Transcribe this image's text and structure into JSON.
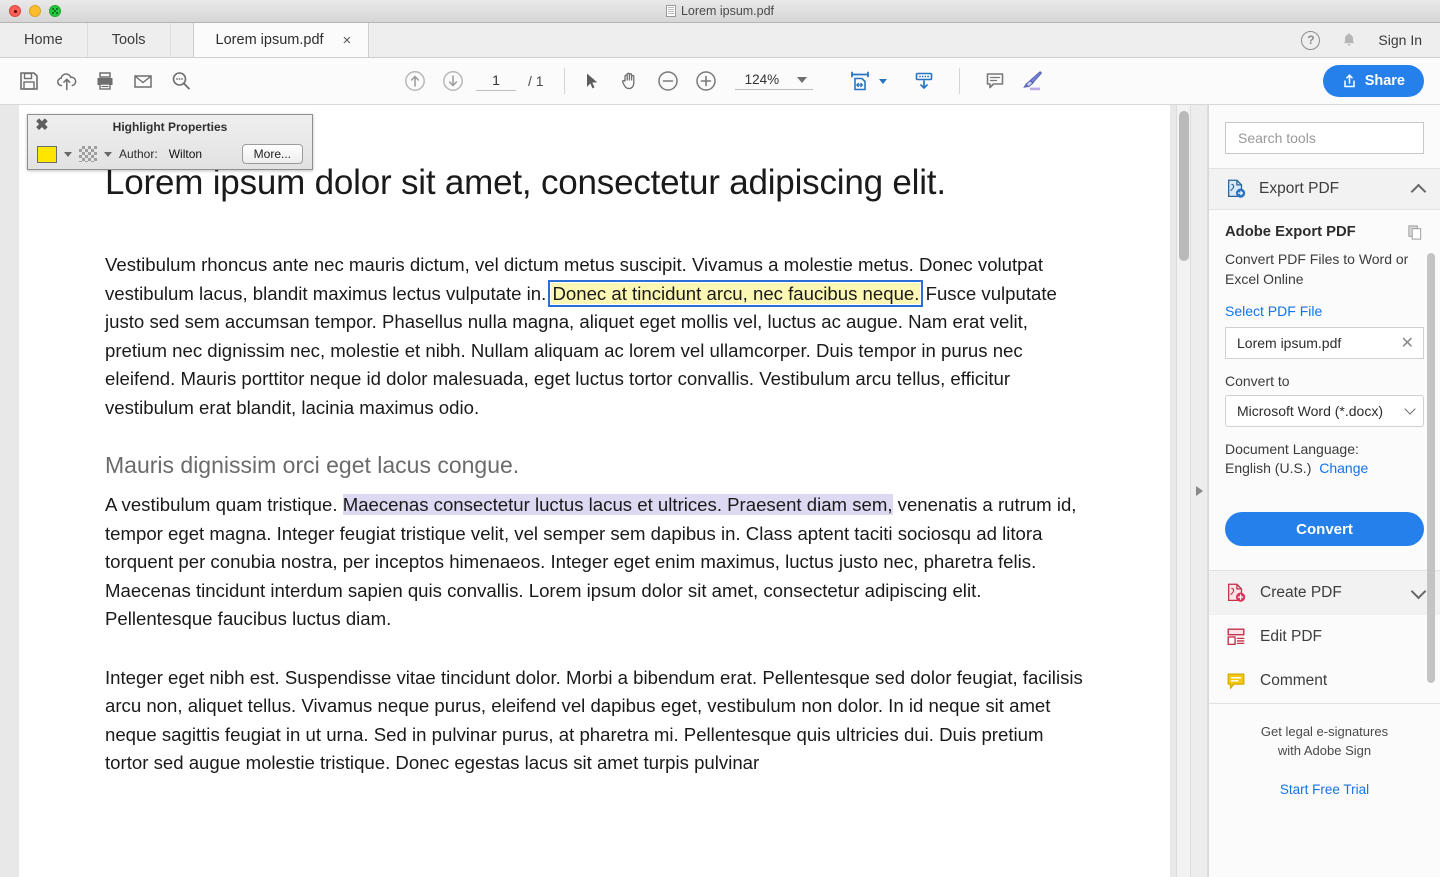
{
  "window": {
    "title": "Lorem ipsum.pdf",
    "traffic_lights": [
      "close",
      "minimize",
      "maximize"
    ]
  },
  "tabbar": {
    "home_label": "Home",
    "tools_label": "Tools",
    "doc_tab_label": "Lorem ipsum.pdf",
    "doc_tab_close": "×",
    "help_icon": "help-circle-icon",
    "bell_icon": "notification-bell-icon",
    "signin_label": "Sign In"
  },
  "toolbar": {
    "save_icon": "save-floppy-icon",
    "cloud_icon": "upload-to-cloud-icon",
    "print_icon": "print-icon",
    "email_icon": "email-icon",
    "search_icon": "search-icon",
    "prev_page_icon": "previous-page-arrow-icon",
    "next_page_icon": "next-page-arrow-icon",
    "page_current": "1",
    "page_total": "/ 1",
    "select_icon": "select-cursor-icon",
    "hand_icon": "hand-pan-icon",
    "zoom_out_icon": "zoom-out-icon",
    "zoom_in_icon": "zoom-in-icon",
    "zoom_value": "124%",
    "fit_icon": "fit-page-width-icon",
    "extract_icon": "scroll-mode-icon",
    "comment_icon": "comment-balloon-icon",
    "highlight_icon": "highlighter-pen-icon",
    "share_label": "Share",
    "share_icon": "share-upload-icon",
    "accent_blue": "#2680eb"
  },
  "highlight_properties": {
    "title": "Highlight Properties",
    "close_label": "✖",
    "color_swatch": "#ffe600",
    "opacity_icon": "opacity-checkerboard-icon",
    "author_label": "Author:",
    "author_value": "Wilton",
    "more_label": "More..."
  },
  "document": {
    "heading1": "Lorem ipsum dolor sit amet, consectetur adipiscing elit.",
    "para1_before": "Vestibulum rhoncus ante nec mauris dictum, vel dictum metus suscipit. Vivamus a molestie metus. Donec volutpat vestibulum lacus, blandit maximus lectus vulputate in.",
    "para1_highlight": "Donec at tincidunt arcu, nec faucibus neque.",
    "para1_after": "Fusce vulputate justo sed sem accumsan tempor. Phasellus nulla magna, aliquet eget mollis vel, luctus ac augue. Nam erat velit, pretium nec dignissim nec, molestie et nibh. Nullam aliquam ac lorem vel ullamcorper. Duis tempor in purus nec eleifend. Mauris porttitor neque id dolor malesuada, eget luctus tortor convallis. Vestibulum arcu tellus, efficitur vestibulum erat blandit, lacinia maximus odio.",
    "heading2": "Mauris dignissim orci eget lacus congue.",
    "para2_before": "A vestibulum quam tristique. ",
    "para2_selected": "Maecenas consectetur luctus lacus et ultrices. Praesent diam sem,",
    "para2_after": " venenatis a rutrum id, tempor eget magna. Integer feugiat tristique velit, vel semper sem dapibus in. Class aptent taciti sociosqu ad litora torquent per conubia nostra, per inceptos himenaeos. Integer eget enim maximus, luctus justo nec, pharetra felis. Maecenas tincidunt interdum sapien quis convallis. Lorem ipsum dolor sit amet, consectetur adipiscing elit. Pellentesque faucibus luctus diam.",
    "para3": "Integer eget nibh est. Suspendisse vitae tincidunt dolor. Morbi a bibendum erat. Pellentesque sed dolor feugiat, facilisis arcu non, aliquet tellus. Vivamus neque purus, eleifend vel dapibus eget, vestibulum non dolor. In id neque sit amet neque sagittis feugiat in ut urna. Sed in pulvinar purus, at pharetra mi. Pellentesque quis ultricies dui. Duis pretium tortor sed augue molestie tristique. Donec egestas lacus sit amet turpis pulvinar",
    "highlight_color": "#fdf7b4",
    "selection_color": "#ddd9f2"
  },
  "sidebar": {
    "search_placeholder": "Search tools",
    "export_panel": {
      "title": "Export PDF",
      "icon": "export-pdf-icon",
      "chevron": "chevron-up-icon",
      "body_title": "Adobe Export PDF",
      "body_icon": "copy-documents-icon",
      "description": "Convert PDF Files to Word or Excel Online",
      "select_file_link": "Select PDF File",
      "file_name": "Lorem ipsum.pdf",
      "file_clear": "✕",
      "convert_to_label": "Convert to",
      "convert_to_value": "Microsoft Word (*.docx)",
      "doc_language_label": "Document Language:",
      "doc_language_value": "English (U.S.)",
      "change_link": "Change",
      "convert_button": "Convert"
    },
    "tools": [
      {
        "label": "Create PDF",
        "icon": "create-pdf-icon",
        "chevron": "chevron-down-icon"
      },
      {
        "label": "Edit PDF",
        "icon": "edit-pdf-icon",
        "chevron": ""
      },
      {
        "label": "Comment",
        "icon": "comment-tool-icon",
        "chevron": ""
      }
    ],
    "promo_line1": "Get legal e-signatures",
    "promo_line2": "with Adobe Sign",
    "promo_link": "Start Free Trial"
  }
}
